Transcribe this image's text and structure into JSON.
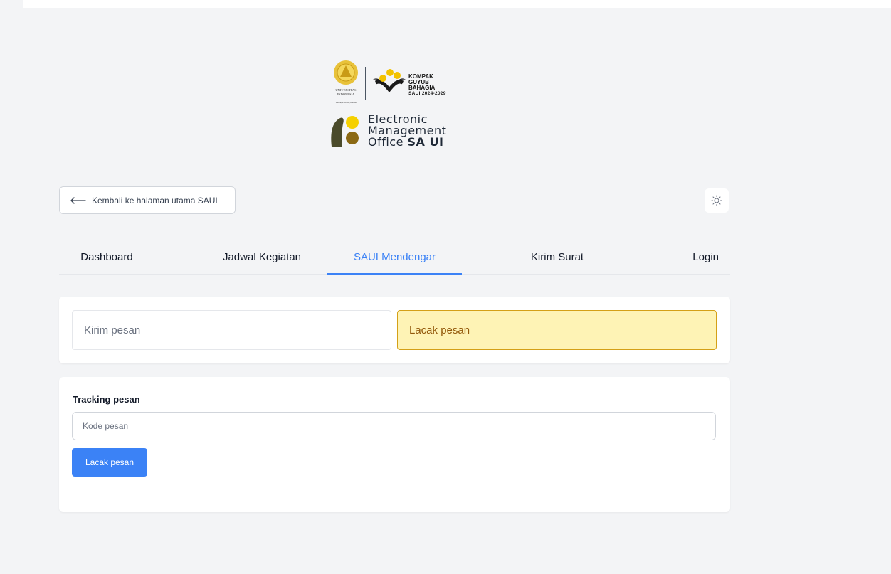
{
  "logos": {
    "ui_seal_lines": [
      "UNIVERSITAS",
      "INDONESIA",
      "Veritas, Probitas, Iustitia"
    ],
    "kgb": {
      "line1": "KOMPAK",
      "line2": "GUYUB",
      "line3": "BAHAGIA",
      "line4": "SAUI 2024-2029"
    },
    "emo": {
      "line1": "Electronic",
      "line2": "Management",
      "line3_prefix": "Office ",
      "line3_bold": "SA UI"
    }
  },
  "back_button": {
    "label": "Kembali ke halaman utama SAUI"
  },
  "theme_toggle": {
    "icon": "sun-icon"
  },
  "tabs": [
    {
      "label": "Dashboard",
      "active": false
    },
    {
      "label": "Jadwal Kegiatan",
      "active": false
    },
    {
      "label": "SAUI Mendengar",
      "active": true
    },
    {
      "label": "Kirim Surat",
      "active": false
    },
    {
      "label": "Login",
      "active": false
    }
  ],
  "options": {
    "send": "Kirim pesan",
    "track": "Lacak pesan"
  },
  "tracking": {
    "label": "Tracking pesan",
    "input_placeholder": "Kode pesan",
    "input_value": "",
    "button_label": "Lacak pesan"
  },
  "colors": {
    "accent": "#3b82f6",
    "selected_bg": "#fef3b5",
    "selected_border": "#d4a017",
    "page_bg": "#f3f4f6"
  }
}
